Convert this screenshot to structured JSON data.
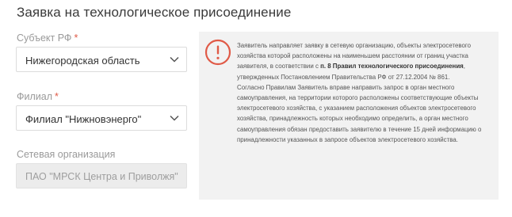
{
  "page": {
    "title": "Заявка на технологическое присоединение"
  },
  "form": {
    "subject": {
      "label": "Субъект РФ",
      "required_mark": "*",
      "value": "Нижегородская область"
    },
    "branch": {
      "label": "Филиал",
      "required_mark": "*",
      "value": "Филиал \"Нижновэнерго\""
    },
    "network_org": {
      "label": "Сетевая организация",
      "value": "ПАО \"МРСК Центра и Приволжя\""
    }
  },
  "info": {
    "icon": "exclamation-circle-icon",
    "paragraph1_start": "Заявитель направляет заявку в сетевую организацию, объекты электросетевого хозяйства которой расположены на наименьшем расстоянии от границ участка заявителя, в соответствии с ",
    "paragraph1_bold": "п. 8 Правил технологического присоединения",
    "paragraph1_end": ", утвержденных Постановлением Правительства РФ от 27.12.2004 № 861.",
    "paragraph2": "Согласно Правилам Заявитель вправе направить запрос в орган местного самоуправления, на территории которого расположены соответствующие объекты электросетевого хозяйства, с указанием расположения объектов электросетевого хозяйства, принадлежность которых необходимо определить, а орган местного самоуправления обязан предоставить заявителю в течение 15 дней информацию о принадлежности указанных в запросе объектов электросетевого хозяйства."
  },
  "colors": {
    "accent": "#e05a47",
    "panel_bg": "#f2f2f2",
    "label": "#9a9a9a"
  }
}
